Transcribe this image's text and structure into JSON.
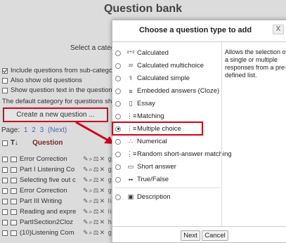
{
  "page": {
    "title": "Question bank",
    "select_category_label": "Select a catego",
    "options": [
      {
        "label": "Include questions from sub-catego",
        "checked": true
      },
      {
        "label": "Also show old questions",
        "checked": false
      },
      {
        "label": "Show question text in the question",
        "checked": false
      }
    ],
    "default_category_text": "The default category for questions sha",
    "create_button": "Create a new question ...",
    "paging_label": "Page:",
    "pages": [
      "1",
      "2",
      "3",
      "(Next)"
    ],
    "table_header": {
      "sort": "T↓",
      "question": "Question"
    },
    "questions": [
      {
        "name": "Error Correction",
        "actions": "✎⌕⚖✕ gu"
      },
      {
        "name": "Part I Listening Co",
        "actions": "✎⌕⚖✕ gu"
      },
      {
        "name": "Selecting five out c",
        "actions": "✎⌕⚖✕ gu"
      },
      {
        "name": "Error Correction",
        "actions": "✎⌕⚖✕ gu"
      },
      {
        "name": "Part III Writing",
        "actions": "✎⌕⚖✕ lia"
      },
      {
        "name": "Reading and expre",
        "actions": "✎⌕⚖✕ lia"
      },
      {
        "name": "PartISection2Cloz",
        "actions": "✎⌕⚖✕ hu"
      },
      {
        "name": "(10)Listening Com",
        "actions": "✎⌕⚖✕ gu"
      }
    ]
  },
  "dialog": {
    "title": "Choose a question type to add",
    "close": "X",
    "types": [
      {
        "icon": "calculated-icon",
        "glyph": "²⁺²",
        "label": "Calculated",
        "selected": false
      },
      {
        "icon": "calculated-multichoice-icon",
        "glyph": "²²",
        "label": "Calculated multichoice",
        "selected": false
      },
      {
        "icon": "calculated-simple-icon",
        "glyph": "⚕",
        "label": "Calculated simple",
        "selected": false
      },
      {
        "icon": "cloze-icon",
        "glyph": "≡",
        "label": "Embedded answers (Cloze)",
        "selected": false
      },
      {
        "icon": "essay-icon",
        "glyph": "▯",
        "label": "Essay",
        "selected": false
      },
      {
        "icon": "matching-icon",
        "glyph": "⋮≡",
        "label": "Matching",
        "selected": false
      },
      {
        "icon": "multiple-choice-icon",
        "glyph": "⋮≡",
        "label": "Multiple choice",
        "selected": true
      },
      {
        "icon": "numerical-icon",
        "glyph": "∴",
        "label": "Numerical",
        "selected": false
      },
      {
        "icon": "random-short-answer-matching-icon",
        "glyph": "⋮≡",
        "label": "Random short-answer matching",
        "selected": false
      },
      {
        "icon": "short-answer-icon",
        "glyph": "▭",
        "label": "Short answer",
        "selected": false
      },
      {
        "icon": "true-false-icon",
        "glyph": "••",
        "label": "True/False",
        "selected": false
      }
    ],
    "other": {
      "icon": "description-icon",
      "glyph": "▣",
      "label": "Description",
      "selected": false
    },
    "description": "Allows the selection of a single or multiple responses from a pre-defined list.",
    "next_button": "Next",
    "cancel_button": "Cancel"
  },
  "colors": {
    "highlight": "#d0021b",
    "link": "#4a69a8"
  }
}
